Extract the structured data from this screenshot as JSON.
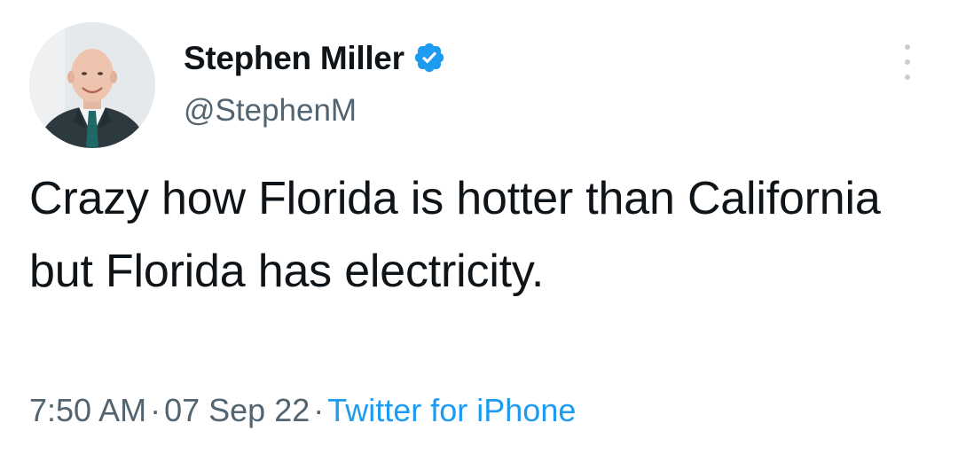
{
  "author": {
    "display_name": "Stephen Miller",
    "handle": "@StephenM",
    "verified": true
  },
  "tweet": {
    "text": "Crazy how Florida is hotter than California but Florida has electricity.",
    "time": "7:50 AM",
    "separator": "·",
    "date": "07 Sep 22",
    "source": "Twitter for iPhone"
  },
  "icons": {
    "verified": "verified-badge-icon",
    "more": "more-options-icon"
  },
  "colors": {
    "verified_badge": "#1d9bf0",
    "link": "#1d9bf0",
    "secondary_text": "#536471",
    "primary_text": "#0f1419"
  }
}
